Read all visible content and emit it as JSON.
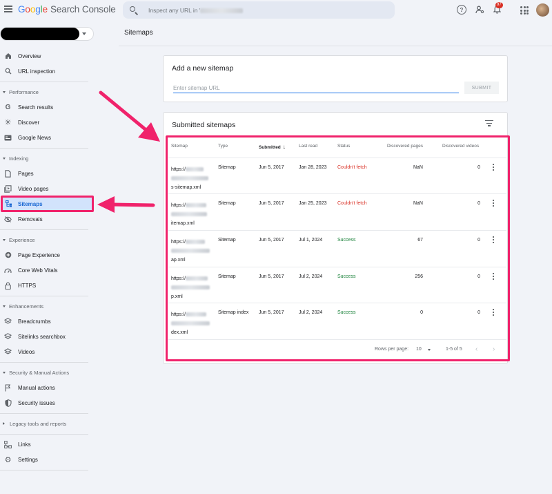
{
  "header": {
    "logo_google": [
      "G",
      "o",
      "o",
      "g",
      "l",
      "e"
    ],
    "logo_product": "Search Console",
    "search_placeholder": "Inspect any URL in '",
    "help_icon_glyph": "?",
    "notification_count": "97"
  },
  "sidebar": {
    "items": [
      {
        "label": "Overview",
        "icon": "home-icon"
      },
      {
        "label": "URL inspection",
        "icon": "search-icon"
      },
      {
        "label": "Search results",
        "icon": "google-g-icon"
      },
      {
        "label": "Discover",
        "icon": "asterisk-icon"
      },
      {
        "label": "Google News",
        "icon": "news-icon"
      },
      {
        "label": "Pages",
        "icon": "page-icon"
      },
      {
        "label": "Video pages",
        "icon": "video-page-icon"
      },
      {
        "label": "Sitemaps",
        "icon": "sitemap-icon"
      },
      {
        "label": "Removals",
        "icon": "eye-off-icon"
      },
      {
        "label": "Page Experience",
        "icon": "plus-circle-icon"
      },
      {
        "label": "Core Web Vitals",
        "icon": "gauge-icon"
      },
      {
        "label": "HTTPS",
        "icon": "lock-icon"
      },
      {
        "label": "Breadcrumbs",
        "icon": "layers-icon"
      },
      {
        "label": "Sitelinks searchbox",
        "icon": "layers-icon"
      },
      {
        "label": "Videos",
        "icon": "layers-icon"
      },
      {
        "label": "Manual actions",
        "icon": "flag-icon"
      },
      {
        "label": "Security issues",
        "icon": "shield-icon"
      },
      {
        "label": "Links",
        "icon": "links-icon"
      },
      {
        "label": "Settings",
        "icon": "gear-icon"
      }
    ],
    "sections": {
      "performance": "Performance",
      "indexing": "Indexing",
      "experience": "Experience",
      "enhancements": "Enhancements",
      "security": "Security & Manual Actions",
      "legacy": "Legacy tools and reports"
    }
  },
  "main": {
    "page_title": "Sitemaps",
    "add_card": {
      "title": "Add a new sitemap",
      "input_placeholder": "Enter sitemap URL",
      "submit_label": "SUBMIT"
    },
    "list_card": {
      "title": "Submitted sitemaps",
      "columns": [
        "Sitemap",
        "Type",
        "Submitted",
        "Last read",
        "Status",
        "Discovered pages",
        "Discovered videos"
      ],
      "rows": [
        {
          "url_start": "https://",
          "url_end": "s-sitemap.xml",
          "type": "Sitemap",
          "submitted": "Jun 5, 2017",
          "last_read": "Jan 28, 2023",
          "status": "Couldn't fetch",
          "status_ok": false,
          "pages": "NaN",
          "videos": "0"
        },
        {
          "url_start": "https://",
          "url_end": "itemap.xml",
          "type": "Sitemap",
          "submitted": "Jun 5, 2017",
          "last_read": "Jan 25, 2023",
          "status": "Couldn't fetch",
          "status_ok": false,
          "pages": "NaN",
          "videos": "0"
        },
        {
          "url_start": "https://",
          "url_end": "ap.xml",
          "type": "Sitemap",
          "submitted": "Jun 5, 2017",
          "last_read": "Jul 1, 2024",
          "status": "Success",
          "status_ok": true,
          "pages": "67",
          "videos": "0"
        },
        {
          "url_start": "https://",
          "url_end": "p.xml",
          "type": "Sitemap",
          "submitted": "Jun 5, 2017",
          "last_read": "Jul 2, 2024",
          "status": "Success",
          "status_ok": true,
          "pages": "256",
          "videos": "0"
        },
        {
          "url_start": "https://",
          "url_end": "dex.xml",
          "type": "Sitemap index",
          "submitted": "Jun 5, 2017",
          "last_read": "Jul 2, 2024",
          "status": "Success",
          "status_ok": true,
          "pages": "0",
          "videos": "0"
        }
      ],
      "pager": {
        "rows_per_page_label": "Rows per page:",
        "rows_per_page_value": "10",
        "range": "1-5 of 5"
      }
    }
  },
  "colors": {
    "annotation": "#f0226b",
    "accent": "#1a73e8",
    "error": "#d93025",
    "success": "#188038"
  }
}
